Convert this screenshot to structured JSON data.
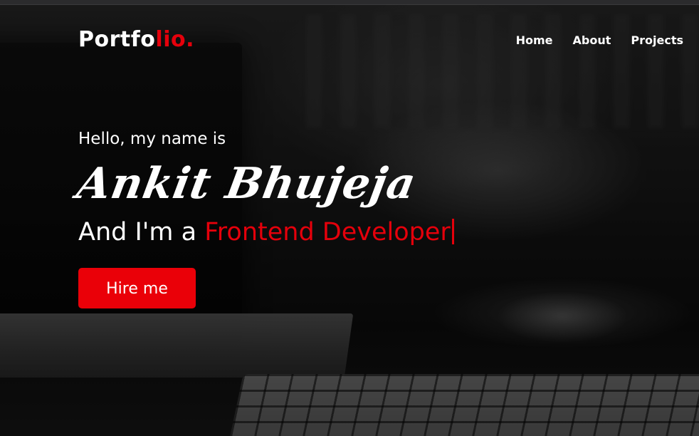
{
  "navbar": {
    "logo_main": "Portfo",
    "logo_accent": "lio.",
    "menu": [
      {
        "label": "Home"
      },
      {
        "label": "About"
      },
      {
        "label": "Projects"
      }
    ]
  },
  "hero": {
    "greeting": "Hello, my name is",
    "name": "Ankit Bhujeja",
    "role_prefix": "And I'm a ",
    "role_highlight": "Frontend Developer",
    "hire_button": "Hire me"
  },
  "colors": {
    "accent": "#e5000b",
    "button": "#ea0008",
    "text": "#ffffff",
    "background": "#0b0b0c"
  }
}
